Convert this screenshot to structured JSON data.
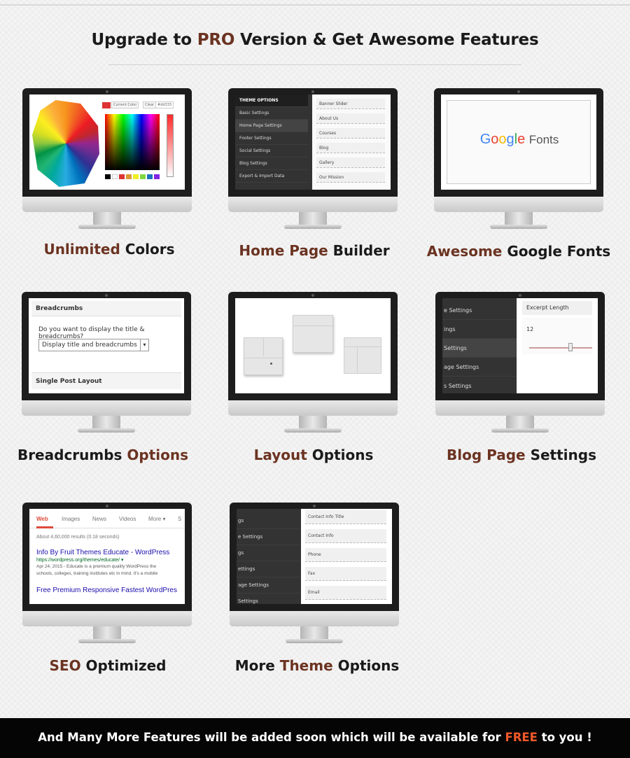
{
  "header": {
    "before": "Upgrade to ",
    "accent": "PRO",
    "after": " Version & Get Awesome Features"
  },
  "features": {
    "colors": {
      "accent": "Unlimited",
      "rest": " Colors",
      "screen": {
        "current_color": "Current Color",
        "clear": "Clear",
        "hex": "#dd333"
      }
    },
    "homepage": {
      "accent": "Home Page",
      "rest": " Builder",
      "screen": {
        "menu_title": "THEME OPTIONS",
        "menu": [
          "Basic Settings",
          "Home Page Settings",
          "Footer Settings",
          "Social Settings",
          "Blog Settings",
          "Export & Import Data"
        ],
        "fields": [
          "Banner Slider",
          "About Us",
          "Courses",
          "Blog",
          "Gallery",
          "Our Mission"
        ]
      }
    },
    "fonts": {
      "accent": "Awesome",
      "rest": " Google Fonts",
      "screen": {
        "google": "Google",
        "fonts": "Fonts"
      }
    },
    "breadcrumbs": {
      "lead": "Breadcrumbs ",
      "accent": "Options",
      "screen": {
        "title": "Breadcrumbs",
        "question": "Do you want to display the title & breadcrumbs?",
        "select_value": "Display title and breadcrumbs",
        "footer": "Single Post Layout"
      }
    },
    "layout": {
      "accent": "Layout",
      "rest": " Options"
    },
    "blog": {
      "accent": "Blog Page",
      "rest": " Settings",
      "screen": {
        "menu": [
          "e Settings",
          "ings",
          "Settings",
          "age Settings",
          "s Settings"
        ],
        "field_title": "Excerpt Length",
        "field_value": "12"
      }
    },
    "seo": {
      "accent": "SEO",
      "rest": " Optimized",
      "screen": {
        "tabs": [
          "Web",
          "Images",
          "News",
          "Videos",
          "More ▾",
          "S"
        ],
        "stats": "About 4,60,000 results (0.18 seconds)",
        "result1_title": "Info By Fruit Themes Educate - WordPress",
        "result1_url": "https://wordpress.org/themes/educate/ ▾",
        "snippet1": "Apr 24, 2015 - Educate is a premium quality WordPress the",
        "snippet2": "schools, colleges, training institutes etc in mind. It's a mobile",
        "result2_title": "Free Premium Responsive Fastest WordPres"
      }
    },
    "more": {
      "lead": "More ",
      "accent": "Theme",
      "rest": " Options",
      "screen": {
        "menu": [
          "gs",
          "e Settings",
          "gs",
          "ettings",
          "age Settings",
          "Settings"
        ],
        "fields": [
          "Contact Info Title",
          "Contact Info",
          "Phone",
          "Fax",
          "Email"
        ]
      }
    }
  },
  "footer": {
    "before": "And Many More Features will be added soon which will be available for ",
    "accent": "FREE",
    "after": " to you !"
  },
  "colors": {
    "accent": "#6b3321",
    "free": "#f1592a"
  }
}
